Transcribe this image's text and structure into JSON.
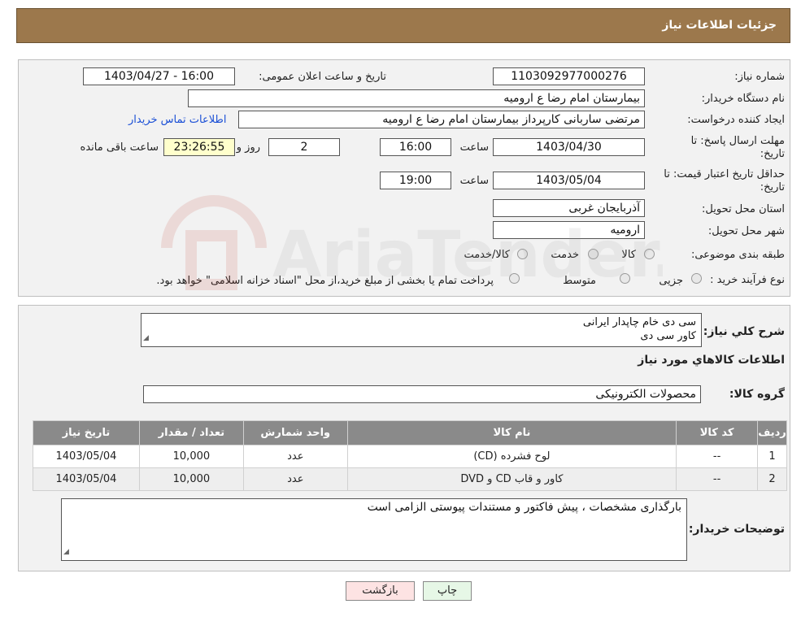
{
  "header": {
    "title": "جزئیات اطلاعات نیاز"
  },
  "form": {
    "need_number_label": "شماره نیاز:",
    "need_number": "1103092977000276",
    "announce_label": "تاریخ و ساعت اعلان عمومی:",
    "announce_value": "1403/04/27 - 16:00",
    "buyer_org_label": "نام دستگاه خریدار:",
    "buyer_org": "بیمارستان امام رضا  ع  ارومیه",
    "creator_label": "ایجاد کننده درخواست:",
    "creator": "مرتضی ساربانی کارپرداز بیمارستان امام رضا  ع  ارومیه",
    "contact_link": "اطلاعات تماس خریدار",
    "deadline_label_line1": "مهلت ارسال پاسخ: تا",
    "deadline_label_line2": "تاریخ:",
    "deadline_date": "1403/04/30",
    "time_label": "ساعت",
    "deadline_time": "16:00",
    "days_value": "2",
    "days_label": "روز و",
    "remaining_time": "23:26:55",
    "remaining_label": "ساعت باقی مانده",
    "validity_label_line1": "حداقل تاریخ اعتبار قیمت: تا",
    "validity_label_line2": "تاریخ:",
    "validity_date": "1403/05/04",
    "validity_time": "19:00",
    "province_label": "استان محل تحویل:",
    "province": "آذربایجان غربی",
    "city_label": "شهر محل تحویل:",
    "city": "ارومیه",
    "category_label": "طبقه بندی موضوعی:",
    "category_options": [
      "کالا",
      "خدمت",
      "کالا/خدمت"
    ],
    "process_label": "نوع فرآیند خرید :",
    "process_options": [
      "جزیی",
      "متوسط"
    ],
    "process_note": "پرداخت تمام یا بخشی از مبلغ خرید،از محل \"اسناد خزانه اسلامی\" خواهد بود."
  },
  "details": {
    "description_label": "شرح کلي نياز:",
    "description_line1": "سی دی خام چاپدار ایرانی",
    "description_line2": "کاور سی دی",
    "goods_info_title": "اطلاعات کالاهاي مورد نياز",
    "group_label": "گروه کالا:",
    "group_value": "محصولات الکترونیکی",
    "table": {
      "headers": [
        "ردیف",
        "کد کالا",
        "نام کالا",
        "واحد شمارش",
        "تعداد / مقدار",
        "تاریخ نیاز"
      ],
      "rows": [
        [
          "1",
          "--",
          "لوح فشرده (CD)",
          "عدد",
          "10,000",
          "1403/05/04"
        ],
        [
          "2",
          "--",
          "کاور و قاب CD و DVD",
          "عدد",
          "10,000",
          "1403/05/04"
        ]
      ]
    },
    "buyer_notes_label": "توضیحات خریدار:",
    "buyer_notes": "بارگذاری مشخصات ، پیش فاکتور و مستندات پیوستی الزامی است"
  },
  "buttons": {
    "print": "چاپ",
    "back": "بازگشت"
  },
  "colors": {
    "header_bg": "#9c784c",
    "table_header_bg": "#8a8a8a",
    "link": "#1a4fd6"
  }
}
